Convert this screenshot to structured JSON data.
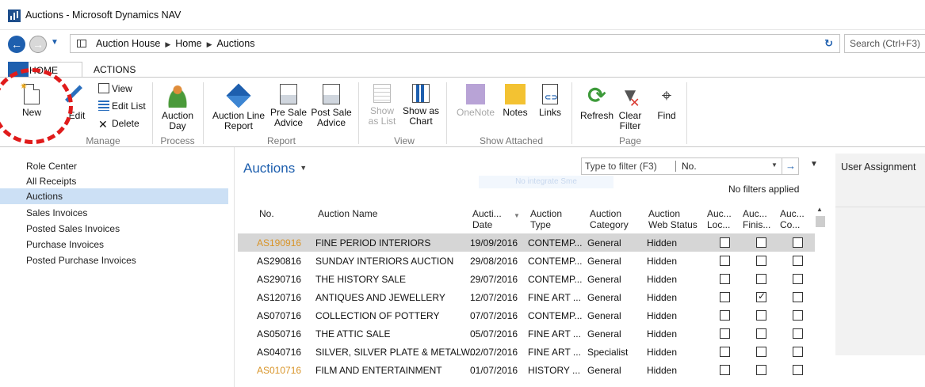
{
  "window": {
    "title": "Auctions - Microsoft Dynamics NAV"
  },
  "address": {
    "crumbs": [
      "Auction House",
      "Home",
      "Auctions"
    ],
    "search_placeholder": "Search (Ctrl+F3)"
  },
  "ribbon": {
    "tabs": [
      "HOME",
      "ACTIONS"
    ],
    "buttons": {
      "new": "New",
      "edit": "Edit",
      "view": "View",
      "edit_list": "Edit List",
      "delete": "Delete",
      "auction_day": [
        "Auction",
        "Day"
      ],
      "auction_line_report": [
        "Auction Line",
        "Report"
      ],
      "pre_sale_advice": [
        "Pre Sale",
        "Advice"
      ],
      "post_sale_advice": [
        "Post Sale",
        "Advice"
      ],
      "show_as_list": [
        "Show",
        "as List"
      ],
      "show_as_chart": [
        "Show as",
        "Chart"
      ],
      "onenote": "OneNote",
      "notes": "Notes",
      "links": "Links",
      "refresh": "Refresh",
      "clear_filter": [
        "Clear",
        "Filter"
      ],
      "find": "Find"
    },
    "groups": [
      "Manage",
      "Process",
      "Report",
      "View",
      "Show Attached",
      "Page"
    ]
  },
  "nav": {
    "items": [
      "Role Center",
      "All Receipts",
      "Auctions",
      "Sales Invoices",
      "Posted Sales Invoices",
      "Purchase Invoices",
      "Posted Purchase Invoices"
    ],
    "active_index": 2
  },
  "main": {
    "title": "Auctions",
    "filter": {
      "placeholder": "Type to filter (F3)",
      "field": "No.",
      "status": "No filters applied"
    },
    "overlay_text": "No integrate Sme",
    "columns": {
      "no": [
        "No.",
        ""
      ],
      "name": [
        "Auction Name",
        ""
      ],
      "date": [
        "Aucti...",
        "Date"
      ],
      "type": [
        "Auction",
        "Type"
      ],
      "category": [
        "Auction",
        "Category"
      ],
      "web_status": [
        "Auction",
        "Web Status"
      ],
      "loc": [
        "Auc...",
        "Loc..."
      ],
      "finished": [
        "Auc...",
        "Finis..."
      ],
      "co": [
        "Auc...",
        "Co..."
      ]
    },
    "rows": [
      {
        "no": "AS190916",
        "name": "FINE PERIOD INTERIORS",
        "date": "19/09/2016",
        "type": "CONTEMP...",
        "category": "General",
        "web": "Hidden",
        "loc": false,
        "finished": false,
        "co": false,
        "orange": true,
        "selected": true
      },
      {
        "no": "AS290816",
        "name": "SUNDAY INTERIORS AUCTION",
        "date": "29/08/2016",
        "type": "CONTEMP...",
        "category": "General",
        "web": "Hidden",
        "loc": false,
        "finished": false,
        "co": false,
        "orange": false,
        "selected": false
      },
      {
        "no": "AS290716",
        "name": "THE HISTORY SALE",
        "date": "29/07/2016",
        "type": "CONTEMP...",
        "category": "General",
        "web": "Hidden",
        "loc": false,
        "finished": false,
        "co": false,
        "orange": false,
        "selected": false
      },
      {
        "no": "AS120716",
        "name": "ANTIQUES AND JEWELLERY",
        "date": "12/07/2016",
        "type": "FINE ART ...",
        "category": "General",
        "web": "Hidden",
        "loc": false,
        "finished": true,
        "co": false,
        "orange": false,
        "selected": false
      },
      {
        "no": "AS070716",
        "name": "COLLECTION OF POTTERY",
        "date": "07/07/2016",
        "type": "CONTEMP...",
        "category": "General",
        "web": "Hidden",
        "loc": false,
        "finished": false,
        "co": false,
        "orange": false,
        "selected": false
      },
      {
        "no": "AS050716",
        "name": "THE ATTIC SALE",
        "date": "05/07/2016",
        "type": "FINE ART ...",
        "category": "General",
        "web": "Hidden",
        "loc": false,
        "finished": false,
        "co": false,
        "orange": false,
        "selected": false
      },
      {
        "no": "AS040716",
        "name": "SILVER, SILVER PLATE & METALW...",
        "date": "02/07/2016",
        "type": "FINE ART ...",
        "category": "Specialist",
        "web": "Hidden",
        "loc": false,
        "finished": false,
        "co": false,
        "orange": false,
        "selected": false
      },
      {
        "no": "AS010716",
        "name": "FILM AND ENTERTAINMENT",
        "date": "01/07/2016",
        "type": "HISTORY ...",
        "category": "General",
        "web": "Hidden",
        "loc": false,
        "finished": false,
        "co": false,
        "orange": true,
        "selected": false
      }
    ]
  },
  "right_panel": {
    "title": "User Assignment"
  },
  "icons": {
    "app_logo": "dynamics-nav-logo-icon",
    "back": "back-arrow-icon",
    "forward": "forward-arrow-icon",
    "refresh": "refresh-icon"
  },
  "colors": {
    "accent": "#1e5fae",
    "selected_nav": "#cce0f5",
    "selected_row": "#d6d6d6",
    "orange_link": "#d89428",
    "highlight": "#e01b1b"
  }
}
